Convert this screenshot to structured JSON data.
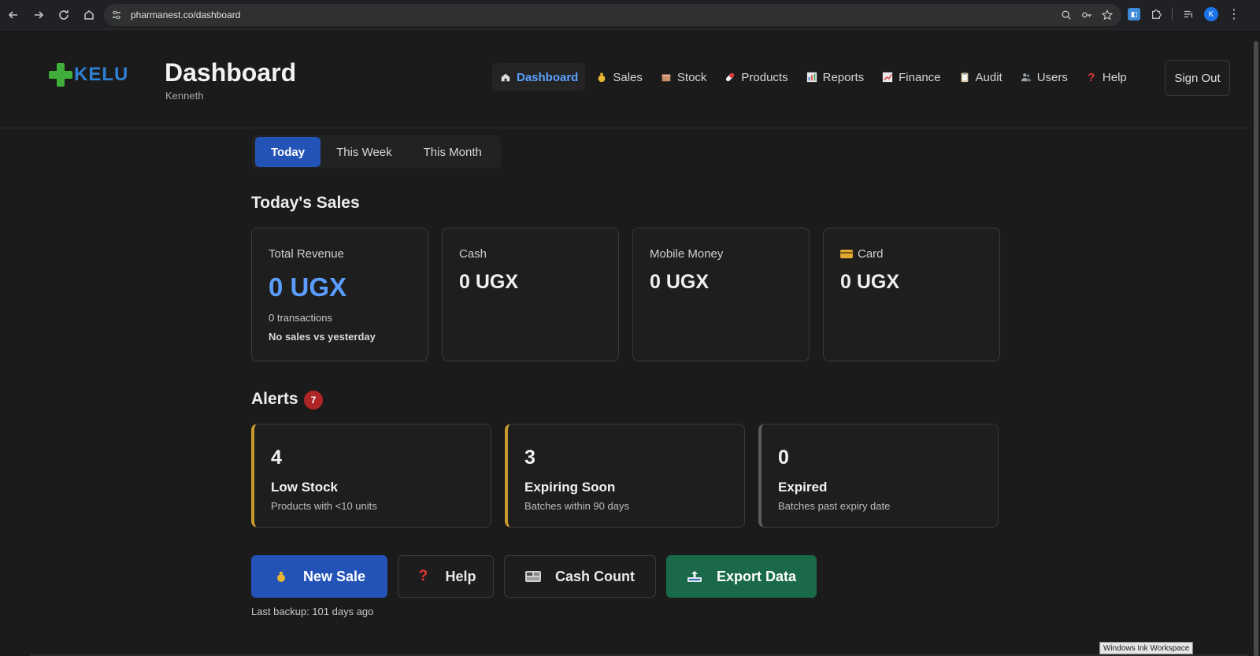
{
  "browser": {
    "url": "pharmanest.co/dashboard",
    "avatar_initial": "K"
  },
  "app": {
    "logo_text": "KELU",
    "title": "Dashboard",
    "user": "Kenneth",
    "nav": [
      {
        "label": "Dashboard",
        "icon": "home-icon",
        "active": true
      },
      {
        "label": "Sales",
        "icon": "money-bag-icon"
      },
      {
        "label": "Stock",
        "icon": "box-icon"
      },
      {
        "label": "Products",
        "icon": "pill-icon"
      },
      {
        "label": "Reports",
        "icon": "bar-chart-icon"
      },
      {
        "label": "Finance",
        "icon": "trend-chart-icon"
      },
      {
        "label": "Audit",
        "icon": "clipboard-icon"
      },
      {
        "label": "Users",
        "icon": "users-icon"
      },
      {
        "label": "Help",
        "icon": "question-icon"
      }
    ],
    "sign_out": "Sign Out"
  },
  "period_tabs": [
    "Today",
    "This Week",
    "This Month"
  ],
  "sales": {
    "title": "Today's Sales",
    "total_revenue": {
      "label": "Total Revenue",
      "value": "0 UGX",
      "transactions": "0 transactions",
      "comparison": "No sales vs yesterday"
    },
    "cash": {
      "label": "Cash",
      "value": "0 UGX"
    },
    "mobile_money": {
      "label": "Mobile Money",
      "value": "0 UGX"
    },
    "card": {
      "label": "Card",
      "value": "0 UGX",
      "icon": "credit-card-icon"
    }
  },
  "alerts": {
    "title": "Alerts",
    "count": "7",
    "items": [
      {
        "number": "4",
        "title": "Low Stock",
        "desc": "Products with <10 units"
      },
      {
        "number": "3",
        "title": "Expiring Soon",
        "desc": "Batches within 90 days"
      },
      {
        "number": "0",
        "title": "Expired",
        "desc": "Batches past expiry date"
      }
    ]
  },
  "actions": {
    "new_sale": "New Sale",
    "help": "Help",
    "cash_count": "Cash Count",
    "export_data": "Export Data"
  },
  "backup_text": "Last backup: 101 days ago",
  "ink_workspace": "Windows Ink Workspace",
  "colors": {
    "accent_blue": "#2453b8",
    "revenue_blue": "#5b9dff",
    "export_green": "#1a6a4a",
    "warning_amber": "#c79a2d",
    "badge_red": "#b02525"
  }
}
